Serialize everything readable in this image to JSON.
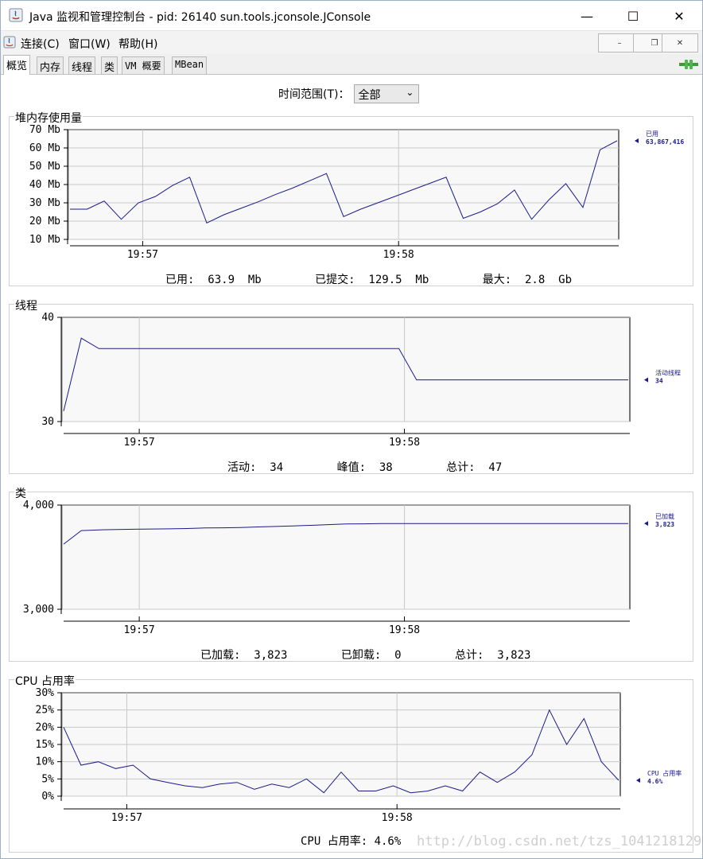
{
  "window": {
    "title": "Java 监视和管理控制台 - pid: 26140 sun.tools.jconsole.JConsole",
    "minimize": "—",
    "maximize": "☐",
    "close": "✕"
  },
  "menu": {
    "items": [
      "连接(C)",
      "窗口(W)",
      "帮助(H)"
    ],
    "mdi_buttons": [
      "–",
      "❐",
      "✕"
    ]
  },
  "tabs": [
    "概览",
    "内存",
    "线程",
    "类",
    "VM 概要",
    "MBean"
  ],
  "active_tab": "概览",
  "time_range": {
    "label": "时间范围(T)：",
    "value": "全部",
    "arrow": "⌄"
  },
  "colors": {
    "line": "#1a1a8c",
    "grid": "#c8c8c8",
    "plot_bg": "#f8f8f8"
  },
  "panels": {
    "heap": {
      "title": "堆内存使用量",
      "summary": "已用:  63.9  Mb        已提交:  129.5  Mb        最大:  2.8  Gb",
      "legend_name": "已用",
      "legend_value": "63,867,416"
    },
    "threads": {
      "title": "线程",
      "summary": "活动:  34        峰值:  38        总计:  47",
      "legend_name": "活动线程",
      "legend_value": "34"
    },
    "classes": {
      "title": "类",
      "summary": "已加载:  3,823        已卸载:  0        总计:  3,823",
      "legend_name": "已加载",
      "legend_value": "3,823"
    },
    "cpu": {
      "title": "CPU 占用率",
      "summary": "CPU 占用率: 4.6%",
      "legend_name": "CPU 占用率",
      "legend_value": "4.6%"
    }
  },
  "chart_data": [
    {
      "type": "line",
      "title": "堆内存使用量",
      "ylabel": "",
      "yticks": [
        "10 Mb",
        "20 Mb",
        "30 Mb",
        "40 Mb",
        "50 Mb",
        "60 Mb",
        "70 Mb"
      ],
      "ylim": [
        10,
        70
      ],
      "xticks": [
        "19:57",
        "19:58"
      ],
      "series": [
        {
          "name": "已用",
          "values": [
            26.5,
            26.5,
            31,
            21,
            30,
            33.5,
            39.5,
            44,
            19,
            23.5,
            27,
            30.5,
            34.5,
            38,
            42,
            46,
            22.5,
            26.5,
            30,
            33.5,
            37,
            40.5,
            44,
            21.5,
            25,
            29.5,
            37,
            21,
            31.5,
            40.5,
            27.5,
            59,
            63.9
          ]
        }
      ]
    },
    {
      "type": "line",
      "title": "线程",
      "yticks": [
        "30",
        "40"
      ],
      "ylim": [
        30,
        40
      ],
      "xticks": [
        "19:57",
        "19:58"
      ],
      "series": [
        {
          "name": "活动线程",
          "values": [
            31,
            38,
            37,
            37,
            37,
            37,
            37,
            37,
            37,
            37,
            37,
            37,
            37,
            37,
            37,
            37,
            37,
            37,
            37,
            37,
            34,
            34,
            34,
            34,
            34,
            34,
            34,
            34,
            34,
            34,
            34,
            34,
            34
          ]
        }
      ]
    },
    {
      "type": "line",
      "title": "类",
      "yticks": [
        "3,000",
        "4,000"
      ],
      "ylim": [
        3000,
        4000
      ],
      "xticks": [
        "19:57",
        "19:58"
      ],
      "series": [
        {
          "name": "已加载",
          "values": [
            3625,
            3755,
            3762,
            3765,
            3768,
            3770,
            3772,
            3775,
            3780,
            3782,
            3785,
            3790,
            3795,
            3800,
            3805,
            3812,
            3818,
            3820,
            3822,
            3823,
            3823,
            3823,
            3823,
            3823,
            3823,
            3823,
            3823,
            3823,
            3823,
            3823,
            3823,
            3823,
            3823
          ]
        }
      ]
    },
    {
      "type": "line",
      "title": "CPU 占用率",
      "yticks": [
        "0%",
        "5%",
        "10%",
        "15%",
        "20%",
        "25%",
        "30%"
      ],
      "ylim": [
        0,
        30
      ],
      "xticks": [
        "19:57",
        "19:58"
      ],
      "series": [
        {
          "name": "CPU 占用率",
          "values": [
            20,
            9,
            10,
            8,
            9,
            5,
            4,
            3,
            2.5,
            3.5,
            4,
            2,
            3.5,
            2.5,
            5,
            1,
            7,
            1.5,
            1.5,
            3,
            1,
            1.5,
            3,
            1.5,
            7,
            4,
            7,
            12,
            25,
            15,
            22.5,
            10,
            4.6
          ]
        }
      ]
    }
  ],
  "watermark": "http://blog.csdn.net/tzs_1041218129"
}
